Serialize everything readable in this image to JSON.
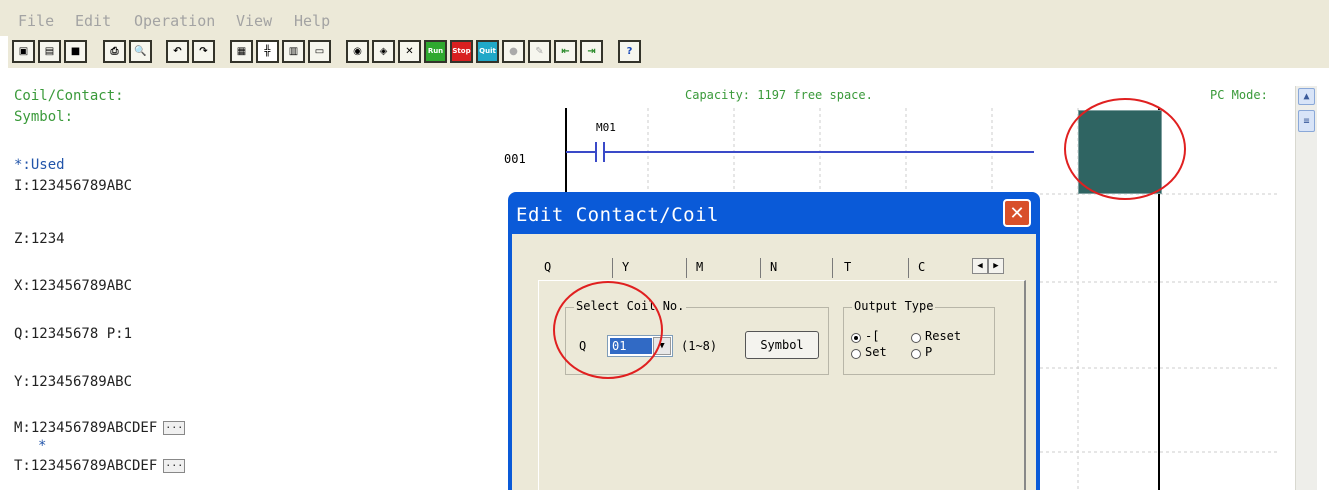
{
  "menu": [
    "File",
    "Edit",
    "Operation",
    "View",
    "Help"
  ],
  "toolbar": {
    "buttons": [
      {
        "name": "new-file",
        "glyph": "▣"
      },
      {
        "name": "open-file",
        "glyph": "▤"
      },
      {
        "name": "save-file",
        "glyph": "■"
      },
      {
        "name": "print",
        "glyph": "⎙"
      },
      {
        "name": "print-preview",
        "glyph": "🔍"
      },
      {
        "name": "undo",
        "glyph": "↶"
      },
      {
        "name": "redo",
        "glyph": "↷"
      },
      {
        "name": "ladder-mode",
        "glyph": "▦"
      },
      {
        "name": "ladder-edit",
        "glyph": "╬"
      },
      {
        "name": "function-block",
        "glyph": "▥"
      },
      {
        "name": "text-view",
        "glyph": "▭"
      },
      {
        "name": "connect",
        "glyph": "◉"
      },
      {
        "name": "monitor",
        "glyph": "◈"
      },
      {
        "name": "tools",
        "glyph": "✕"
      },
      {
        "name": "run",
        "glyph": "Run"
      },
      {
        "name": "stop",
        "glyph": "Stop"
      },
      {
        "name": "quit",
        "glyph": "Quit"
      },
      {
        "name": "simulate",
        "glyph": "●"
      },
      {
        "name": "pen",
        "glyph": "✎"
      },
      {
        "name": "read-plc",
        "glyph": "⇤"
      },
      {
        "name": "write-plc",
        "glyph": "⇥"
      },
      {
        "name": "help",
        "glyph": "?"
      }
    ]
  },
  "left": {
    "coil_contact_label": "Coil/Contact:",
    "symbol_label": "Symbol:",
    "used_label": "*:Used",
    "line_I": "I:123456789ABC",
    "line_Z": "Z:1234",
    "line_X": "X:123456789ABC",
    "line_Q": "Q:12345678 P:1",
    "line_Y": "Y:123456789ABC",
    "line_M": "M:123456789ABCDEF",
    "used_marker": "*",
    "line_T": "T:123456789ABCDEF"
  },
  "ladder": {
    "capacity": "Capacity: 1197 free space.",
    "pc_mode": "PC Mode:",
    "row_number": "001",
    "contact_label": "M01"
  },
  "dialog": {
    "title": "Edit Contact/Coil",
    "close_glyph": "✕",
    "tabs": [
      "Q",
      "Y",
      "M",
      "N",
      "T",
      "C"
    ],
    "select_coil_group": "Select Coil No.",
    "coil_prefix": "Q",
    "coil_value": "01",
    "coil_range": "(1~8)",
    "symbol_button": "Symbol",
    "output_type_group": "Output Type",
    "output_options": {
      "coil": "-[",
      "reset": "Reset",
      "set": "Set",
      "pulse": "P"
    },
    "selected_output": "coil"
  },
  "colors": {
    "highlight_red": "#e02020",
    "output_block": "#2f6462",
    "dialog_title_bar": "#0a5ad8",
    "green_text": "#3a9a3a"
  }
}
